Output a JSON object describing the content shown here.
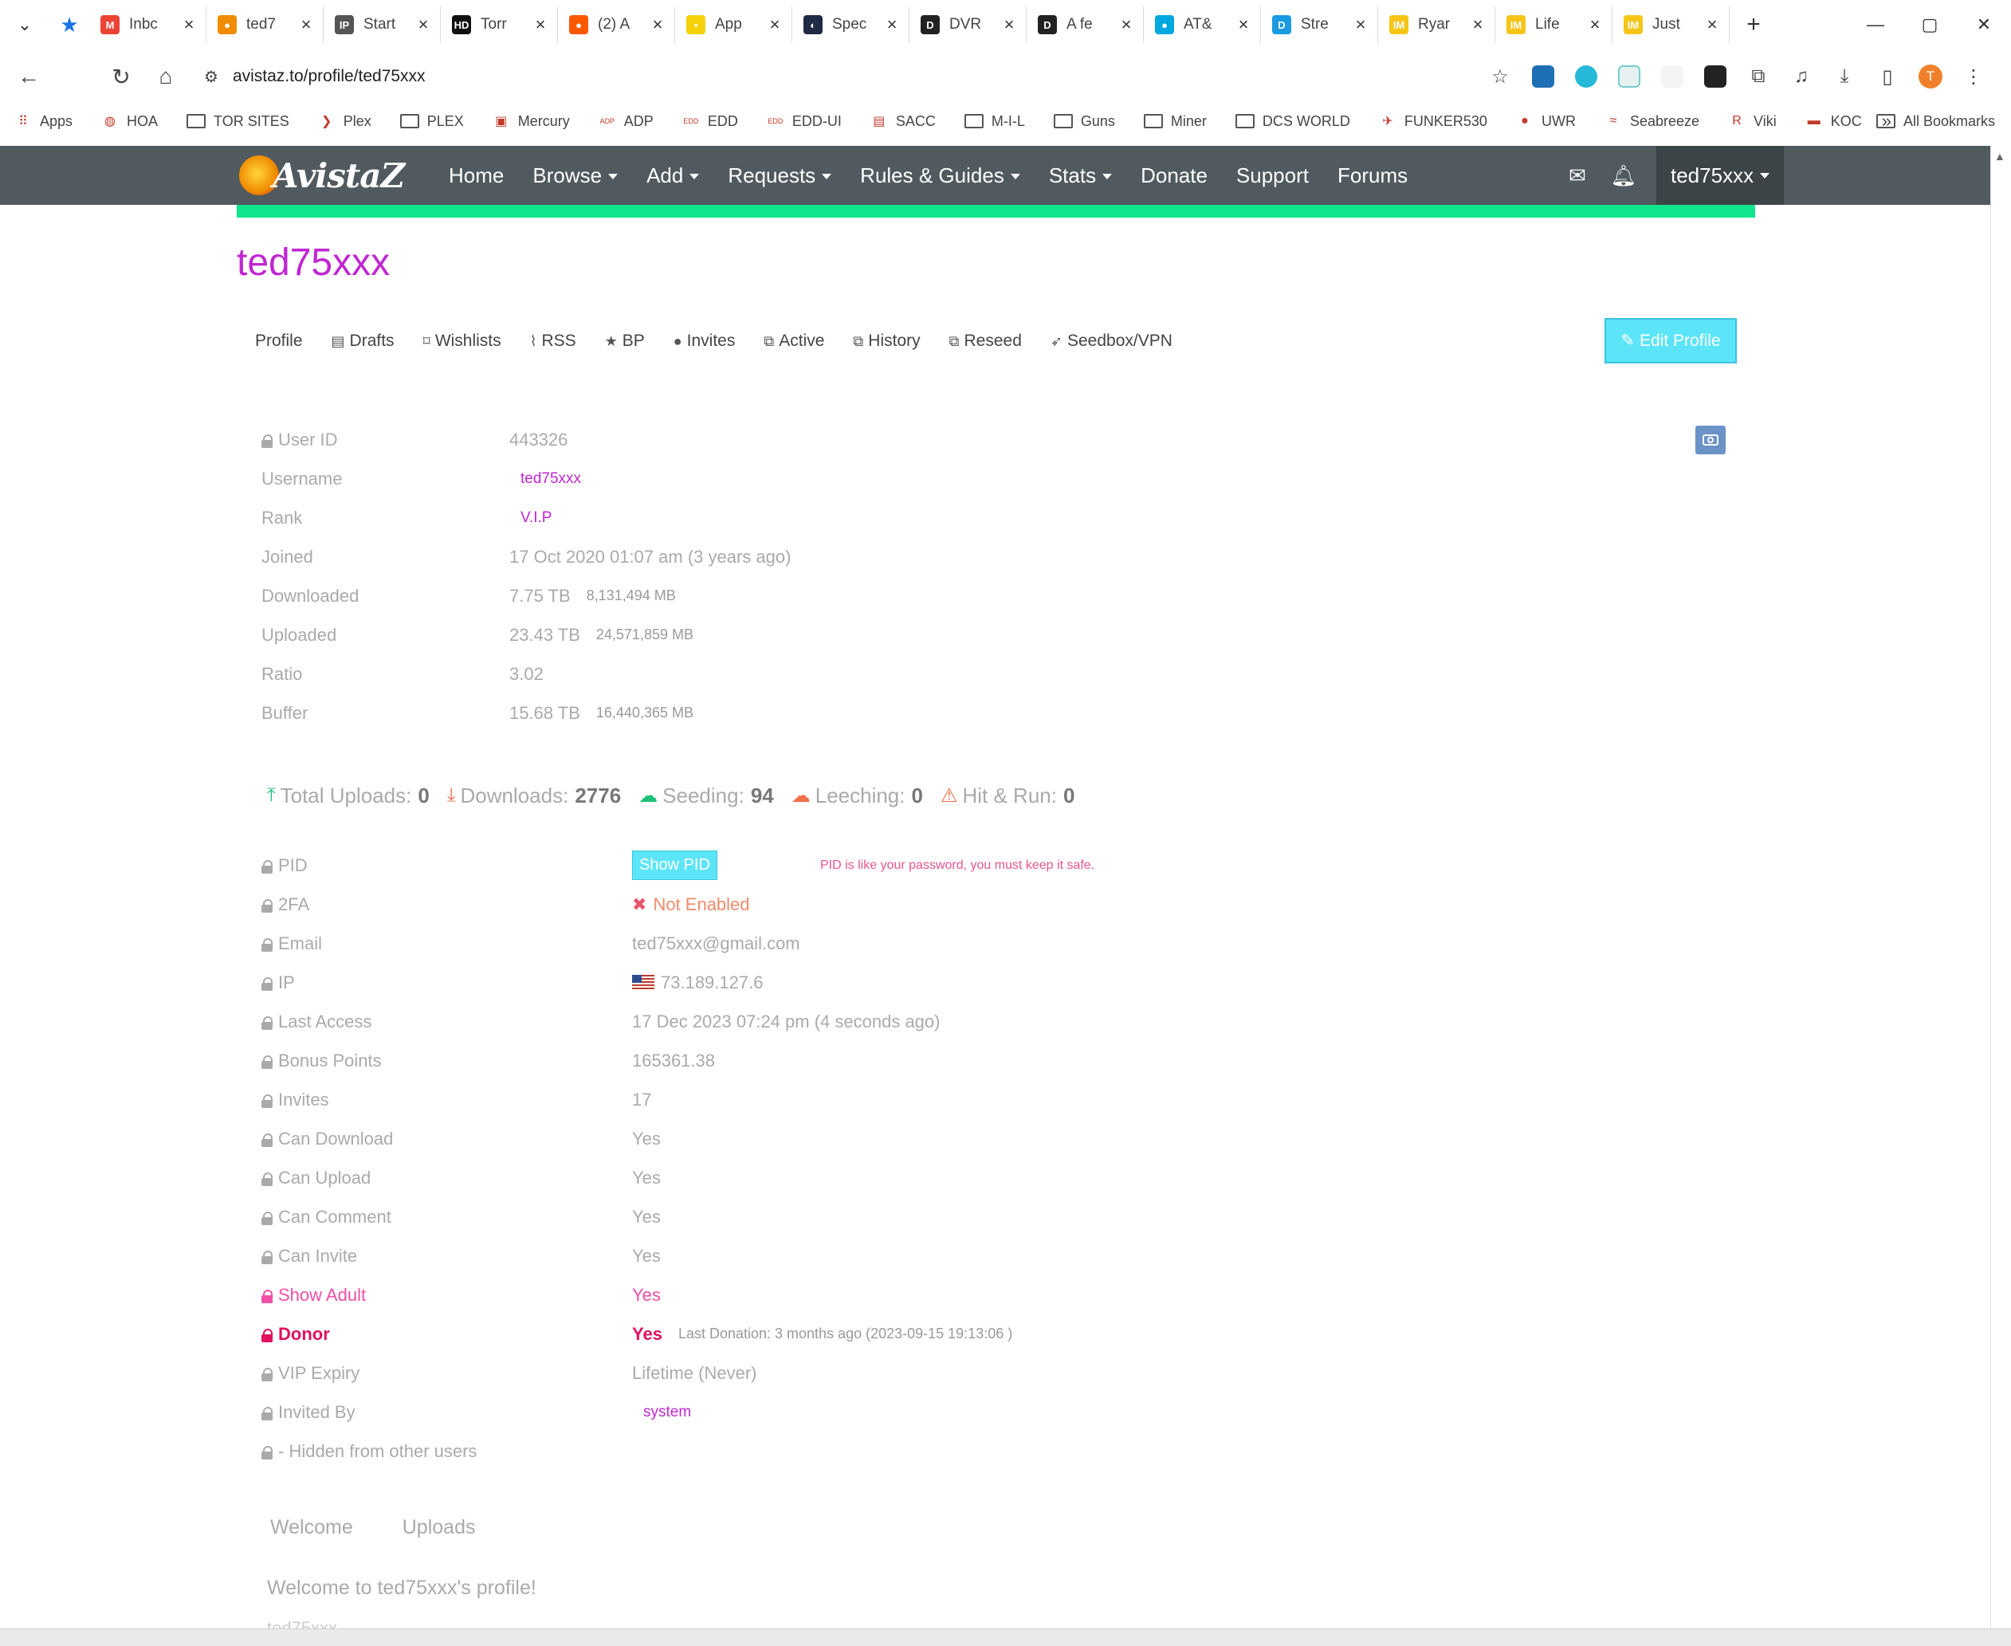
{
  "browser": {
    "tabs": [
      {
        "title": "Inbc",
        "icon": "gmail-icon",
        "color": "#ea4335",
        "glyph": "M"
      },
      {
        "title": "ted7",
        "icon": "avistaz-icon",
        "color": "#f08c00",
        "glyph": "●"
      },
      {
        "title": "Start",
        "icon": "ipt-icon",
        "color": "#555555",
        "glyph": "IP"
      },
      {
        "title": "Torr",
        "icon": "hd-icon",
        "color": "#111111",
        "glyph": "HD"
      },
      {
        "title": "(2) A",
        "icon": "reddit-icon",
        "color": "#ff5700",
        "glyph": "●"
      },
      {
        "title": "App",
        "icon": "dice-icon",
        "color": "#f5d10a",
        "glyph": "▪"
      },
      {
        "title": "Spec",
        "icon": "speed-icon",
        "color": "#1f2a44",
        "glyph": "◐"
      },
      {
        "title": "DVR",
        "icon": "directv-icon",
        "color": "#222222",
        "glyph": "D"
      },
      {
        "title": "A fe",
        "icon": "directv-icon",
        "color": "#222222",
        "glyph": "D"
      },
      {
        "title": "AT&",
        "icon": "att-icon",
        "color": "#00a8e0",
        "glyph": "●"
      },
      {
        "title": "Stre",
        "icon": "directv-stream-icon",
        "color": "#1a9ae0",
        "glyph": "D"
      },
      {
        "title": "Ryar",
        "icon": "imdb-icon",
        "color": "#f5c518",
        "glyph": "IM"
      },
      {
        "title": "Life",
        "icon": "imdb-icon",
        "color": "#f5c518",
        "glyph": "IM"
      },
      {
        "title": "Just",
        "icon": "imdb-icon",
        "color": "#f5c518",
        "glyph": "IM"
      }
    ],
    "url": "avistaz.to/profile/ted75xxx",
    "profile_initial": "T",
    "bookmarks": [
      {
        "label": "Apps",
        "icon": "apps-grid-icon",
        "glyph": "⠿"
      },
      {
        "label": "HOA",
        "icon": "globe-icon",
        "glyph": "◍"
      },
      {
        "label": "TOR SITES",
        "icon": "folder-icon",
        "glyph": ""
      },
      {
        "label": "Plex",
        "icon": "plex-icon",
        "glyph": "❯"
      },
      {
        "label": "PLEX",
        "icon": "folder-icon",
        "glyph": ""
      },
      {
        "label": "Mercury",
        "icon": "mercury-icon",
        "glyph": "▣"
      },
      {
        "label": "ADP",
        "icon": "adp-icon",
        "glyph": "ADP"
      },
      {
        "label": "EDD",
        "icon": "edd-icon",
        "glyph": "EDD"
      },
      {
        "label": "EDD-UI",
        "icon": "edd-icon",
        "glyph": "EDD"
      },
      {
        "label": "SACC",
        "icon": "sacc-icon",
        "glyph": "▤"
      },
      {
        "label": "M-I-L",
        "icon": "folder-icon",
        "glyph": ""
      },
      {
        "label": "Guns",
        "icon": "folder-icon",
        "glyph": ""
      },
      {
        "label": "Miner",
        "icon": "folder-icon",
        "glyph": ""
      },
      {
        "label": "DCS WORLD",
        "icon": "folder-icon",
        "glyph": ""
      },
      {
        "label": "FUNKER530",
        "icon": "funker-icon",
        "glyph": "✈"
      },
      {
        "label": "UWR",
        "icon": "reddit-icon",
        "glyph": "●"
      },
      {
        "label": "Seabreeze",
        "icon": "seabreeze-icon",
        "glyph": "≈"
      },
      {
        "label": "Viki",
        "icon": "viki-icon",
        "glyph": "R"
      },
      {
        "label": "KOC",
        "icon": "koc-icon",
        "glyph": "▬"
      }
    ],
    "all_bookmarks": "All Bookmarks"
  },
  "site": {
    "logo_text": "AvistaZ",
    "menu": [
      {
        "label": "Home",
        "dropdown": false
      },
      {
        "label": "Browse",
        "dropdown": true
      },
      {
        "label": "Add",
        "dropdown": true
      },
      {
        "label": "Requests",
        "dropdown": true
      },
      {
        "label": "Rules & Guides",
        "dropdown": true
      },
      {
        "label": "Stats",
        "dropdown": true
      },
      {
        "label": "Donate",
        "dropdown": false
      },
      {
        "label": "Support",
        "dropdown": false
      },
      {
        "label": "Forums",
        "dropdown": false
      }
    ],
    "user": "ted75xxx",
    "accent_color": "#10e68c",
    "nav_color": "#505a5f"
  },
  "profile": {
    "title": "ted75xxx",
    "subtabs": [
      {
        "label": "Profile",
        "icon": ""
      },
      {
        "label": "Drafts",
        "icon": "file-icon",
        "glyph": "▤"
      },
      {
        "label": "Wishlists",
        "icon": "bookmark-icon",
        "glyph": "⌑"
      },
      {
        "label": "RSS",
        "icon": "rss-icon",
        "glyph": "⌇"
      },
      {
        "label": "BP",
        "icon": "star-icon",
        "glyph": "★"
      },
      {
        "label": "Invites",
        "icon": "user-icon",
        "glyph": "●"
      },
      {
        "label": "Active",
        "icon": "clone-icon",
        "glyph": "⧉"
      },
      {
        "label": "History",
        "icon": "clone-icon",
        "glyph": "⧉"
      },
      {
        "label": "Reseed",
        "icon": "clone-icon",
        "glyph": "⧉"
      },
      {
        "label": "Seedbox/VPN",
        "icon": "paper-plane-icon",
        "glyph": "➶"
      }
    ],
    "edit_button": "Edit Profile",
    "info": {
      "user_id_label": "User ID",
      "user_id": "443326",
      "username_label": "Username",
      "username": "ted75xxx",
      "rank_label": "Rank",
      "rank": "V.I.P",
      "joined_label": "Joined",
      "joined": "17 Oct 2020 01:07 am (3 years ago)",
      "downloaded_label": "Downloaded",
      "downloaded": "7.75 TB",
      "downloaded_mb": "8,131,494 MB",
      "uploaded_label": "Uploaded",
      "uploaded": "23.43 TB",
      "uploaded_mb": "24,571,859 MB",
      "ratio_label": "Ratio",
      "ratio": "3.02",
      "buffer_label": "Buffer",
      "buffer": "15.68 TB",
      "buffer_mb": "16,440,365 MB"
    },
    "stats": {
      "total_uploads_label": "Total Uploads:",
      "total_uploads": "0",
      "downloads_label": "Downloads:",
      "downloads": "2776",
      "seeding_label": "Seeding:",
      "seeding": "94",
      "leeching_label": "Leeching:",
      "leeching": "0",
      "hnr_label": "Hit & Run:",
      "hnr": "0"
    },
    "security": {
      "pid_label": "PID",
      "pid_button": "Show PID",
      "pid_note": "PID is like your password, you must keep it safe.",
      "twofa_label": "2FA",
      "twofa": "Not Enabled",
      "email_label": "Email",
      "email": "ted75xxx@gmail.com",
      "ip_label": "IP",
      "ip": "73.189.127.6",
      "last_access_label": "Last Access",
      "last_access": "17 Dec 2023 07:24 pm (4 seconds ago)",
      "bonus_label": "Bonus Points",
      "bonus": "165361.38",
      "invites_label": "Invites",
      "invites": "17",
      "can_download_label": "Can Download",
      "can_download": "Yes",
      "can_upload_label": "Can Upload",
      "can_upload": "Yes",
      "can_comment_label": "Can Comment",
      "can_comment": "Yes",
      "can_invite_label": "Can Invite",
      "can_invite": "Yes",
      "show_adult_label": "Show Adult",
      "show_adult": "Yes",
      "donor_label": "Donor",
      "donor": "Yes",
      "donor_note": "Last Donation: 3 months ago (2023-09-15 19:13:06 )",
      "vip_expiry_label": "VIP Expiry",
      "vip_expiry": "Lifetime (Never)",
      "invited_by_label": "Invited By",
      "invited_by": "system",
      "hidden_label": "- Hidden from other users"
    },
    "bottom_tabs": [
      "Welcome",
      "Uploads"
    ],
    "welcome_text": "Welcome to ted75xxx's profile!"
  }
}
